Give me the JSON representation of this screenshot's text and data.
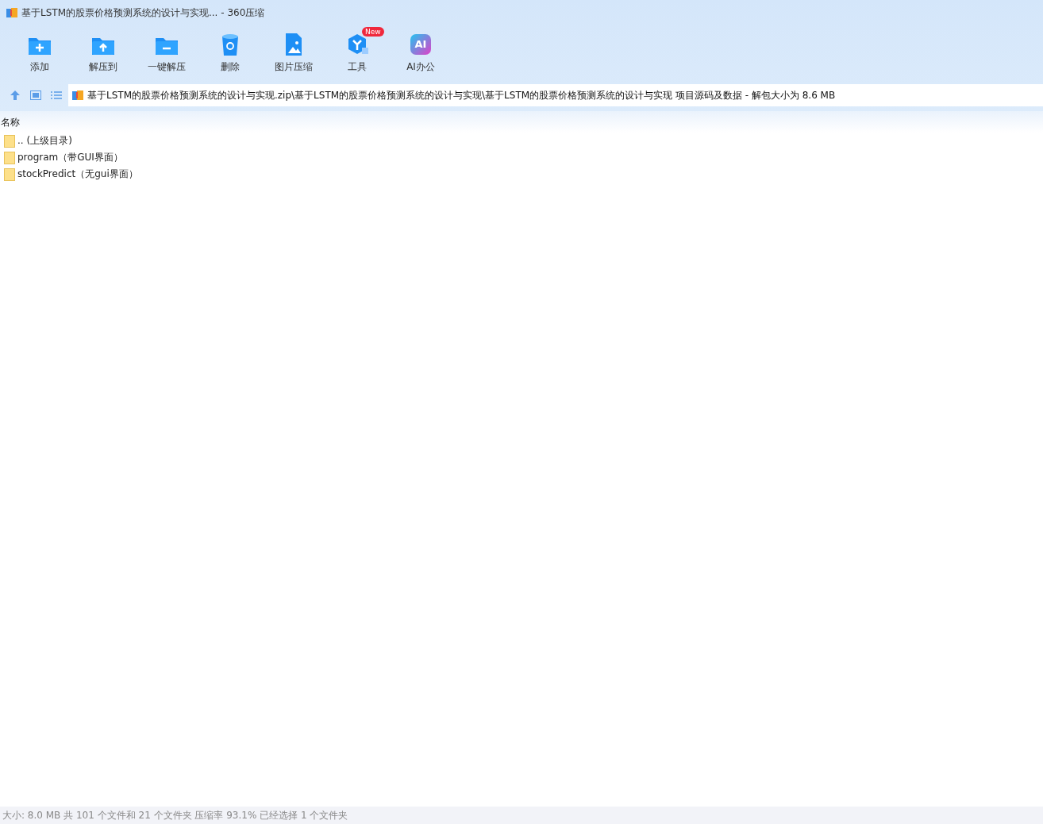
{
  "window": {
    "title": "基于LSTM的股票价格预测系统的设计与实现... - 360压缩"
  },
  "toolbar": [
    {
      "kind": "add",
      "label": "添加"
    },
    {
      "kind": "extract",
      "label": "解压到"
    },
    {
      "kind": "oneclick",
      "label": "一键解压"
    },
    {
      "kind": "delete",
      "label": "删除"
    },
    {
      "kind": "image",
      "label": "图片压缩"
    },
    {
      "kind": "tools",
      "label": "工具",
      "badge": "New"
    },
    {
      "kind": "ai",
      "label": "AI办公",
      "icon_text": "AI"
    }
  ],
  "address_bar": {
    "path": "基于LSTM的股票价格预测系统的设计与实现.zip\\基于LSTM的股票价格预测系统的设计与实现\\基于LSTM的股票价格预测系统的设计与实现 项目源码及数据 - 解包大小为 8.6 MB"
  },
  "file_list": {
    "columns": [
      "名称"
    ],
    "rows": [
      {
        "name": ".. (上级目录)"
      },
      {
        "name": "program（带GUI界面）"
      },
      {
        "name": "stockPredict（无gui界面）"
      }
    ]
  },
  "status_bar": "大小: 8.0 MB 共 101 个文件和 21 个文件夹 压缩率 93.1% 已经选择 1 个文件夹"
}
